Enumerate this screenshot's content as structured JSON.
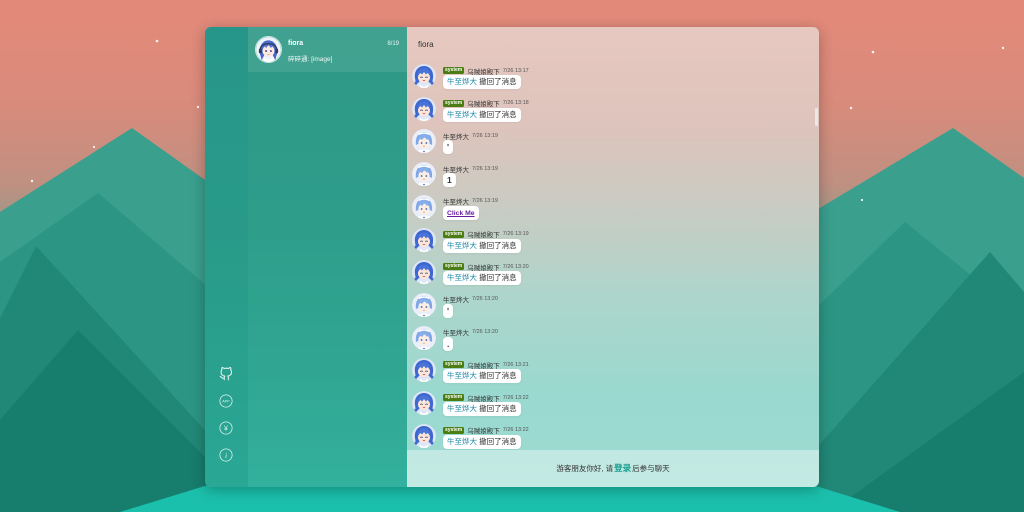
{
  "colors": {
    "accent": "#17a090",
    "system_tag": "#4b7d12",
    "recall_user": "#2189a8",
    "link": "#6a1fa0"
  },
  "sidebar": {
    "icons": [
      {
        "name": "github-icon"
      },
      {
        "name": "app-download-icon",
        "label": "APP"
      },
      {
        "name": "yen-icon",
        "glyph": "¥"
      },
      {
        "name": "info-icon",
        "glyph": "i"
      }
    ]
  },
  "linkman": {
    "items": [
      {
        "avatar": "fiora-avatar",
        "name": "fiora",
        "time": "8/19",
        "preview": "碎碎通: [image]"
      }
    ]
  },
  "chat": {
    "title": "fiora",
    "messages": [
      {
        "avatar": "squid-girl-avatar",
        "tag": "system",
        "name": "乌贼娘殿下",
        "time": "7/26 13:17",
        "content": {
          "user": "牛至烨大",
          "text": "撤回了消息"
        }
      },
      {
        "avatar": "squid-girl-avatar",
        "tag": "system",
        "name": "乌贼娘殿下",
        "time": "7/26 13:18",
        "content": {
          "user": "牛至烨大",
          "text": "撤回了消息"
        }
      },
      {
        "avatar": "blue-hair-girl-avatar",
        "name": "牛至烨大",
        "time": "7/26 13:19",
        "content": {
          "text": "'"
        }
      },
      {
        "avatar": "blue-hair-girl-avatar",
        "name": "牛至烨大",
        "time": "7/26 13:19",
        "content": {
          "text": "1"
        }
      },
      {
        "avatar": "blue-hair-girl-avatar",
        "name": "牛至烨大",
        "time": "7/26 13:19",
        "content": {
          "link": "Click Me"
        }
      },
      {
        "avatar": "squid-girl-avatar",
        "tag": "system",
        "name": "乌贼娘殿下",
        "time": "7/26 13:19",
        "content": {
          "user": "牛至烨大",
          "text": "撤回了消息"
        }
      },
      {
        "avatar": "squid-girl-avatar",
        "tag": "system",
        "name": "乌贼娘殿下",
        "time": "7/26 13:20",
        "content": {
          "user": "牛至烨大",
          "text": "撤回了消息"
        }
      },
      {
        "avatar": "blue-hair-girl-avatar",
        "name": "牛至烨大",
        "time": "7/26 13:20",
        "content": {
          "text": "'"
        }
      },
      {
        "avatar": "blue-hair-girl-avatar",
        "name": "牛至烨大",
        "time": "7/26 13:20",
        "content": {
          "text": "."
        }
      },
      {
        "avatar": "squid-girl-avatar",
        "tag": "system",
        "name": "乌贼娘殿下",
        "time": "7/26 13:21",
        "content": {
          "user": "牛至烨大",
          "text": "撤回了消息"
        }
      },
      {
        "avatar": "squid-girl-avatar",
        "tag": "system",
        "name": "乌贼娘殿下",
        "time": "7/26 13:22",
        "content": {
          "user": "牛至烨大",
          "text": "撤回了消息"
        }
      },
      {
        "avatar": "squid-girl-avatar",
        "tag": "system",
        "name": "乌贼娘殿下",
        "time": "7/26 13:22",
        "content": {
          "user": "牛至烨大",
          "text": "撤回了消息"
        }
      }
    ],
    "footer": {
      "prefix": "游客朋友你好, 请",
      "login": "登录",
      "suffix": "后参与聊天"
    }
  }
}
